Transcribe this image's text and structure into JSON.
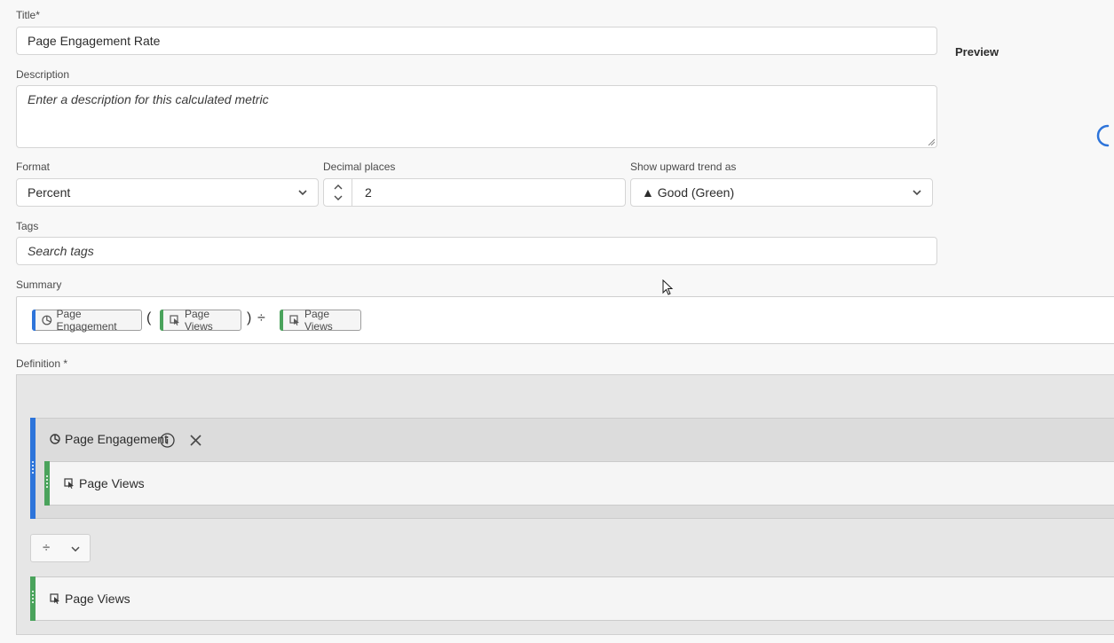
{
  "form": {
    "title_label": "Title*",
    "title_value": "Page Engagement Rate",
    "description_label": "Description",
    "description_placeholder": "Enter a description for this calculated metric",
    "format_label": "Format",
    "format_value": "Percent",
    "decimal_label": "Decimal places",
    "decimal_value": "2",
    "trend_label": "Show upward trend as",
    "trend_value": "▲ Good (Green)",
    "tags_label": "Tags",
    "tags_placeholder": "Search tags",
    "summary_label": "Summary",
    "definition_label": "Definition *"
  },
  "preview": {
    "title": "Preview"
  },
  "summary": {
    "pills": [
      {
        "label": "Page Engagement",
        "icon": "segment-icon",
        "color": "#2d74da"
      },
      {
        "label": "Page Views",
        "icon": "metric-icon",
        "color": "#4aa35c"
      },
      {
        "label": "Page Views",
        "icon": "metric-icon",
        "color": "#4aa35c"
      }
    ],
    "open_paren": "(",
    "close_paren": ")",
    "divide": "÷"
  },
  "definition": {
    "container_title": "Page Engagement",
    "inner_metric": "Page Views",
    "operator": "÷",
    "second_metric": "Page Views"
  },
  "colors": {
    "segment_accent": "#2d74da",
    "metric_accent": "#4aa35c",
    "spinner": "#2d74da"
  }
}
